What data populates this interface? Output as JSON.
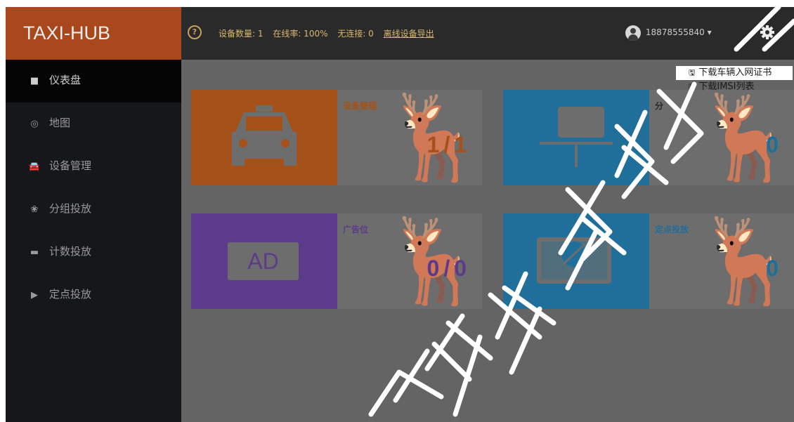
{
  "header": {
    "logo": "TAXI-HUB",
    "help_icon": "question-circle-icon",
    "stats": {
      "device_count": "设备数量: 1",
      "online_rate": "在线率: 100%",
      "no_connection": "无连接: 0",
      "export_link": "离线设备导出"
    },
    "user": "18878555840 ▾",
    "settings_icon": "gear-icon"
  },
  "sidebar": {
    "items": [
      {
        "label": "仪表盘",
        "icon": "dashboard-icon"
      },
      {
        "label": "地图",
        "icon": "map-icon"
      },
      {
        "label": "设备管理",
        "icon": "car-icon"
      },
      {
        "label": "分组投放",
        "icon": "group-icon"
      },
      {
        "label": "计数投放",
        "icon": "keyboard-icon"
      },
      {
        "label": "定点投放",
        "icon": "play-icon"
      }
    ]
  },
  "dropdown": {
    "items": [
      {
        "label": "下载车辆入网证书",
        "icon": "save-icon"
      },
      {
        "label": "下载IMSI列表",
        "icon": "save-icon"
      }
    ]
  },
  "cards": [
    {
      "title": "设备管理",
      "value": "1/1",
      "icon": "taxi-icon",
      "color": "#a45219",
      "title_color": "#a45219",
      "value_color": "#a45219"
    },
    {
      "title": "分",
      "value": "0",
      "icon": "monitor-icon",
      "color": "#1f6f9a",
      "title_color": "#2a2a2a",
      "value_color": "#1f6f9a"
    },
    {
      "title": "广告位",
      "value": "0/0",
      "icon": "ad-icon",
      "ad_text": "AD",
      "color": "#5b3b8a",
      "title_color": "#5b3b8a",
      "value_color": "#5b3b8a"
    },
    {
      "title": "定点投放",
      "value": "0",
      "icon": "target-screen-icon",
      "color": "#1f6f9a",
      "title_color": "#1f6f9a",
      "value_color": "#1f6f9a"
    }
  ],
  "watermark": "子科技有限公"
}
